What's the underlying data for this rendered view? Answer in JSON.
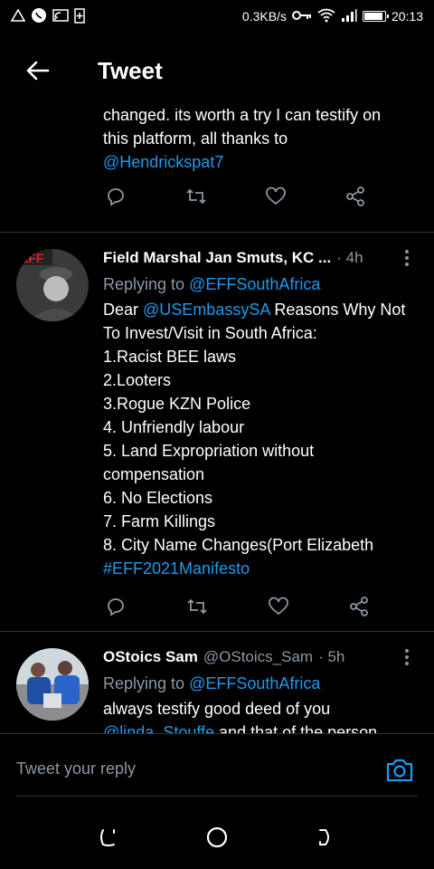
{
  "status_bar": {
    "net_speed": "0.3KB/s",
    "time": "20:13",
    "battery_level": 0.9,
    "icons": [
      "alert-icon",
      "whatsapp-icon",
      "cast-icon",
      "battery-saver-icon",
      "key-icon",
      "wifi-icon",
      "signal-icon"
    ]
  },
  "header": {
    "title": "Tweet"
  },
  "tweets": [
    {
      "fragment": true,
      "lines": [
        "changed. its worth a try I can testify on",
        "this platform, all thanks to"
      ],
      "link_line": "@Hendrickspat7"
    },
    {
      "name": "Field Marshal Jan Smuts, KC ...",
      "dot": "·",
      "time": "4h",
      "replying_prefix": "Replying to",
      "replying_to": "@EFFSouthAfrica",
      "first_line_prefix": "Dear",
      "first_line_mention": "@USEmbassySA",
      "first_line_suffix": " Reasons Why Not",
      "lines": [
        "To Invest/Visit in South Africa:",
        "1.Racist BEE laws",
        "2.Looters",
        "3.Rogue KZN Police",
        "4. Unfriendly labour",
        "5. Land Expropriation without",
        "compensation",
        "6. No Elections",
        "7. Farm Killings",
        "8. City Name Changes(Port Elizabeth"
      ],
      "hashtag": "#EFF2021Manifesto"
    },
    {
      "name": "OStoics Sam",
      "handle": "@OStoics_Sam",
      "dot": "·",
      "time": "5h",
      "replying_prefix": "Replying to",
      "replying_to": "@EFFSouthAfrica",
      "line1": "always testify good deed of you",
      "line2_mention": "@linda_Stouffe",
      "line2_suffix": " and that of the person"
    }
  ],
  "reply_bar": {
    "placeholder": "Tweet your reply"
  },
  "colors": {
    "background": "#000000",
    "link": "#1d9bf0",
    "muted": "#8b98a5",
    "divider": "#2f3336"
  }
}
